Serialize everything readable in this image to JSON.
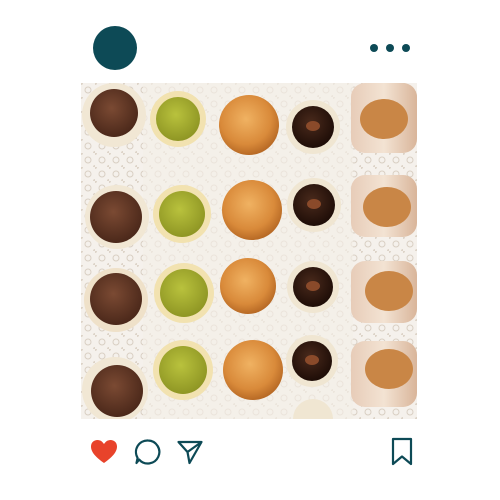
{
  "post": {
    "avatar_icon": "account-avatar-circle",
    "more_icon": "more-options-horizontal-dots",
    "image_subject": "dessert-platter-photo",
    "liked": true
  },
  "actions": {
    "like_icon": "heart-icon",
    "comment_icon": "comment-icon",
    "share_icon": "send-icon",
    "save_icon": "bookmark-icon"
  },
  "colors": {
    "accent": "#0d4a56",
    "like": "#e8432b"
  }
}
